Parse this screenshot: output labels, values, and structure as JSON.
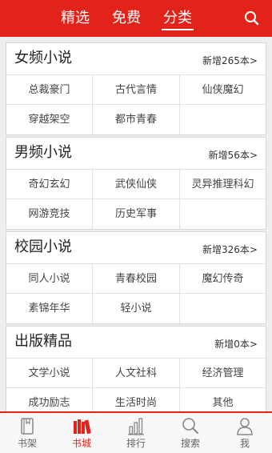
{
  "header": {
    "tabs": [
      {
        "label": "精选",
        "active": false
      },
      {
        "label": "免费",
        "active": false
      },
      {
        "label": "分类",
        "active": true
      }
    ],
    "search_icon": "search-icon",
    "accent_color": "#e2231a"
  },
  "sections": [
    {
      "title": "女频小说",
      "new_count": "新增265本>",
      "items": [
        "总裁豪门",
        "古代言情",
        "仙侠魔幻",
        "穿越架空",
        "都市青春"
      ]
    },
    {
      "title": "男频小说",
      "new_count": "新增56本>",
      "items": [
        "奇幻玄幻",
        "武侠仙侠",
        "灵异推理科幻",
        "网游竞技",
        "历史军事"
      ]
    },
    {
      "title": "校园小说",
      "new_count": "新增326本>",
      "items": [
        "同人小说",
        "青春校园",
        "魔幻传奇",
        "素锦年华",
        "轻小说"
      ]
    },
    {
      "title": "出版精品",
      "new_count": "新增0本>",
      "items": [
        "文学小说",
        "人文社科",
        "经济管理",
        "成功励志",
        "生活时尚",
        "其他"
      ]
    }
  ],
  "bottom_nav": [
    {
      "label": "书架",
      "icon": "bookshelf-icon",
      "active": false
    },
    {
      "label": "书城",
      "icon": "bookstore-icon",
      "active": true
    },
    {
      "label": "排行",
      "icon": "ranking-icon",
      "active": false
    },
    {
      "label": "搜索",
      "icon": "search-icon",
      "active": false
    },
    {
      "label": "我",
      "icon": "user-icon",
      "active": false
    }
  ]
}
